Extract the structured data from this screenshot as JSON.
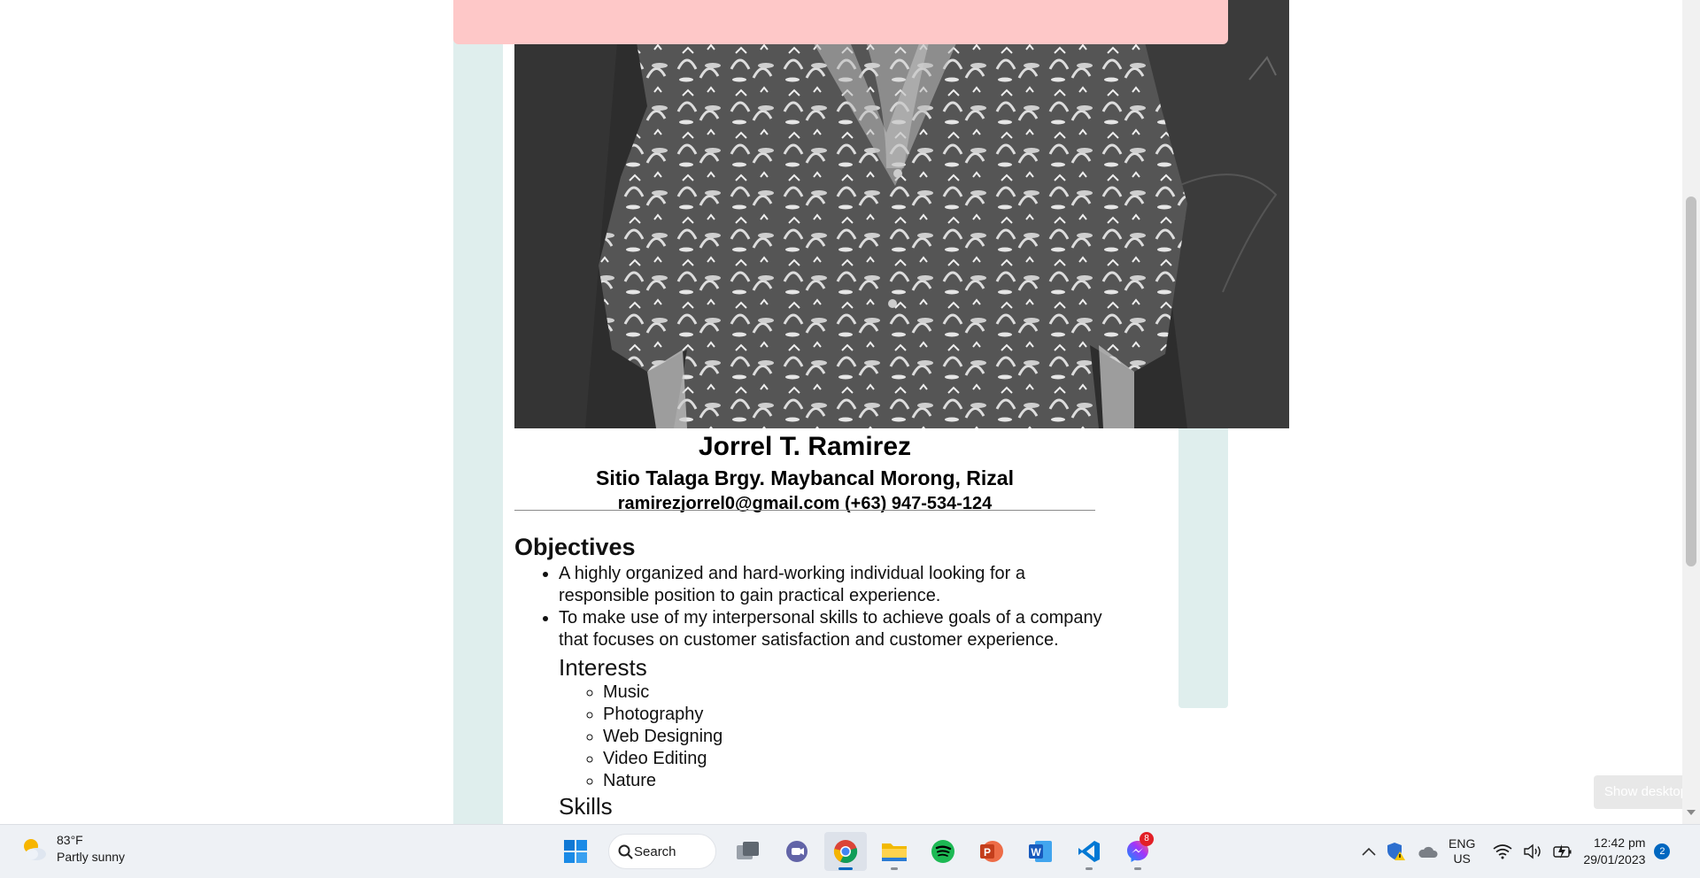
{
  "resume": {
    "name": "Jorrel T. Ramirez",
    "address": "Sitio Talaga Brgy. Maybancal Morong, Rizal",
    "contact": "ramirezjorrel0@gmail.com (+63) 947-534-124",
    "objectives_heading": "Objectives",
    "objectives": [
      "A highly organized and hard-working individual looking for a responsible position to gain practical experience.",
      "To make use of my interpersonal skills to achieve goals of a company that focuses on customer satisfaction and customer experience."
    ],
    "interests_heading": "Interests",
    "interests": [
      "Music",
      "Photography",
      "Web Designing",
      "Video Editing",
      "Nature"
    ],
    "skills_heading": "Skills"
  },
  "overlay": {
    "show_desktop": "Show desktop"
  },
  "taskbar": {
    "weather_temp": "83°F",
    "weather_desc": "Partly sunny",
    "search_label": "Search",
    "messenger_badge": "8",
    "lang_line1": "ENG",
    "lang_line2": "US",
    "time": "12:42 pm",
    "date": "29/01/2023",
    "notifications": "2"
  },
  "colors": {
    "pink_bar": "#fec8c8",
    "teal_side": "#dfeeed",
    "accent": "#0067c0"
  }
}
